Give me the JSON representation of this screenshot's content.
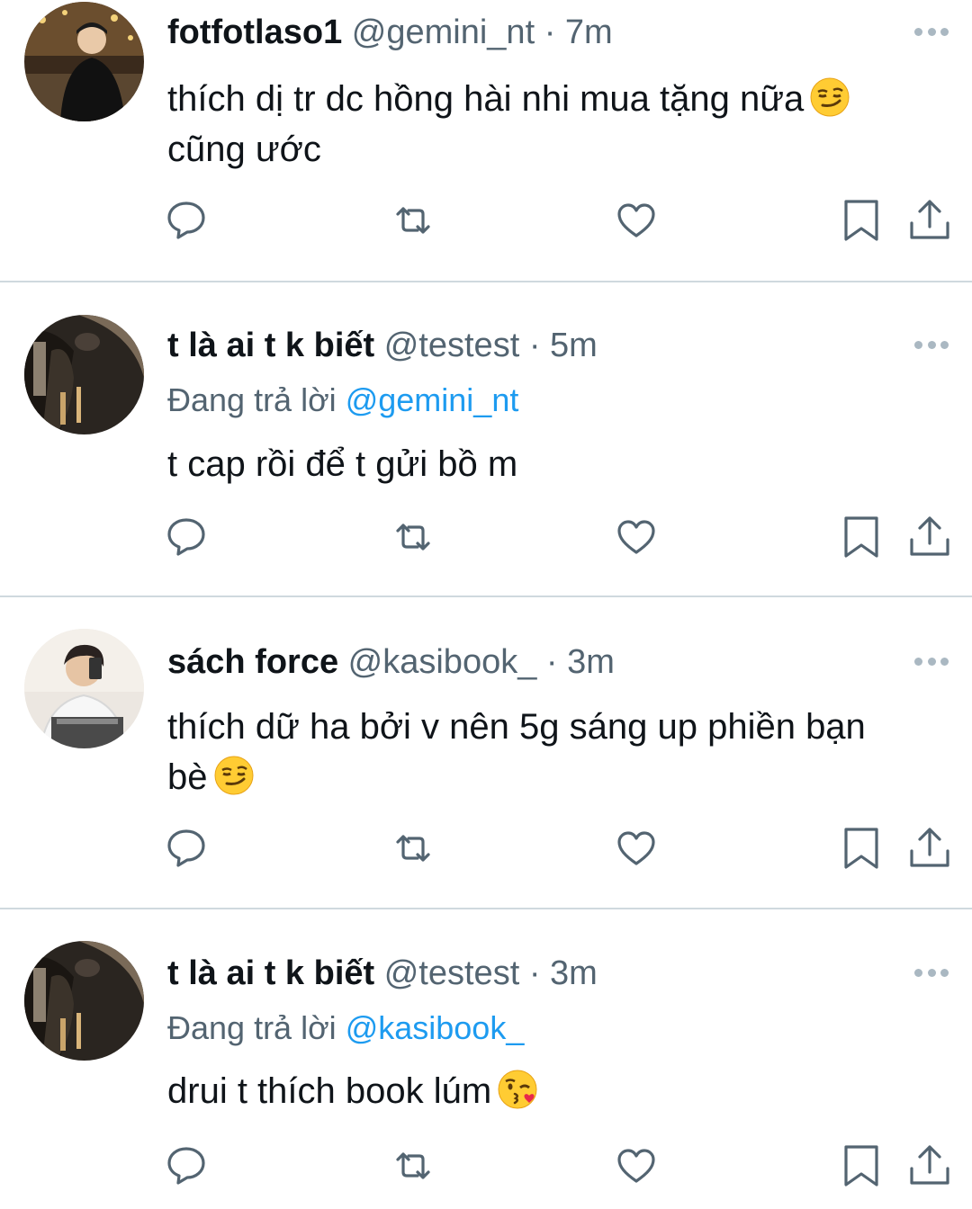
{
  "tweets": [
    {
      "name": "fotfotlaso1",
      "handle": "@gemini_nt",
      "dot": "·",
      "time": "7m",
      "reply_prefix": "",
      "reply_to": "",
      "text_line1": "thích dị tr dc hồng hài nhi mua tặng nữa",
      "text_line2": "cũng ước",
      "emoji": "smirking-face"
    },
    {
      "name": "t là ai t k biết",
      "handle": "@testest",
      "dot": "·",
      "time": "5m",
      "reply_prefix": "Đang trả lời",
      "reply_to": "@gemini_nt",
      "text_line1": "t cap rồi để t gửi bồ m",
      "text_line2": "",
      "emoji": ""
    },
    {
      "name": "sách force",
      "handle": "@kasibook_",
      "dot": "·",
      "time": "3m",
      "reply_prefix": "",
      "reply_to": "",
      "text_line1": "thích dữ ha bởi v nên 5g sáng up phiền bạn",
      "text_line2": "bè",
      "emoji": "smirking-face"
    },
    {
      "name": "t là ai t k biết",
      "handle": "@testest",
      "dot": "·",
      "time": "3m",
      "reply_prefix": "Đang trả lời",
      "reply_to": "@kasibook_",
      "text_line1": "drui t thích book lúm",
      "text_line2": "",
      "emoji": "face-blowing-kiss"
    }
  ],
  "icons": [
    "more-icon",
    "reply-icon",
    "retweet-icon",
    "like-icon",
    "bookmark-icon",
    "share-icon"
  ],
  "colors": {
    "text": "#0f1419",
    "secondary": "#536471",
    "link": "#1d9bf0",
    "divider": "#cfd9de",
    "icon": "#536471"
  }
}
